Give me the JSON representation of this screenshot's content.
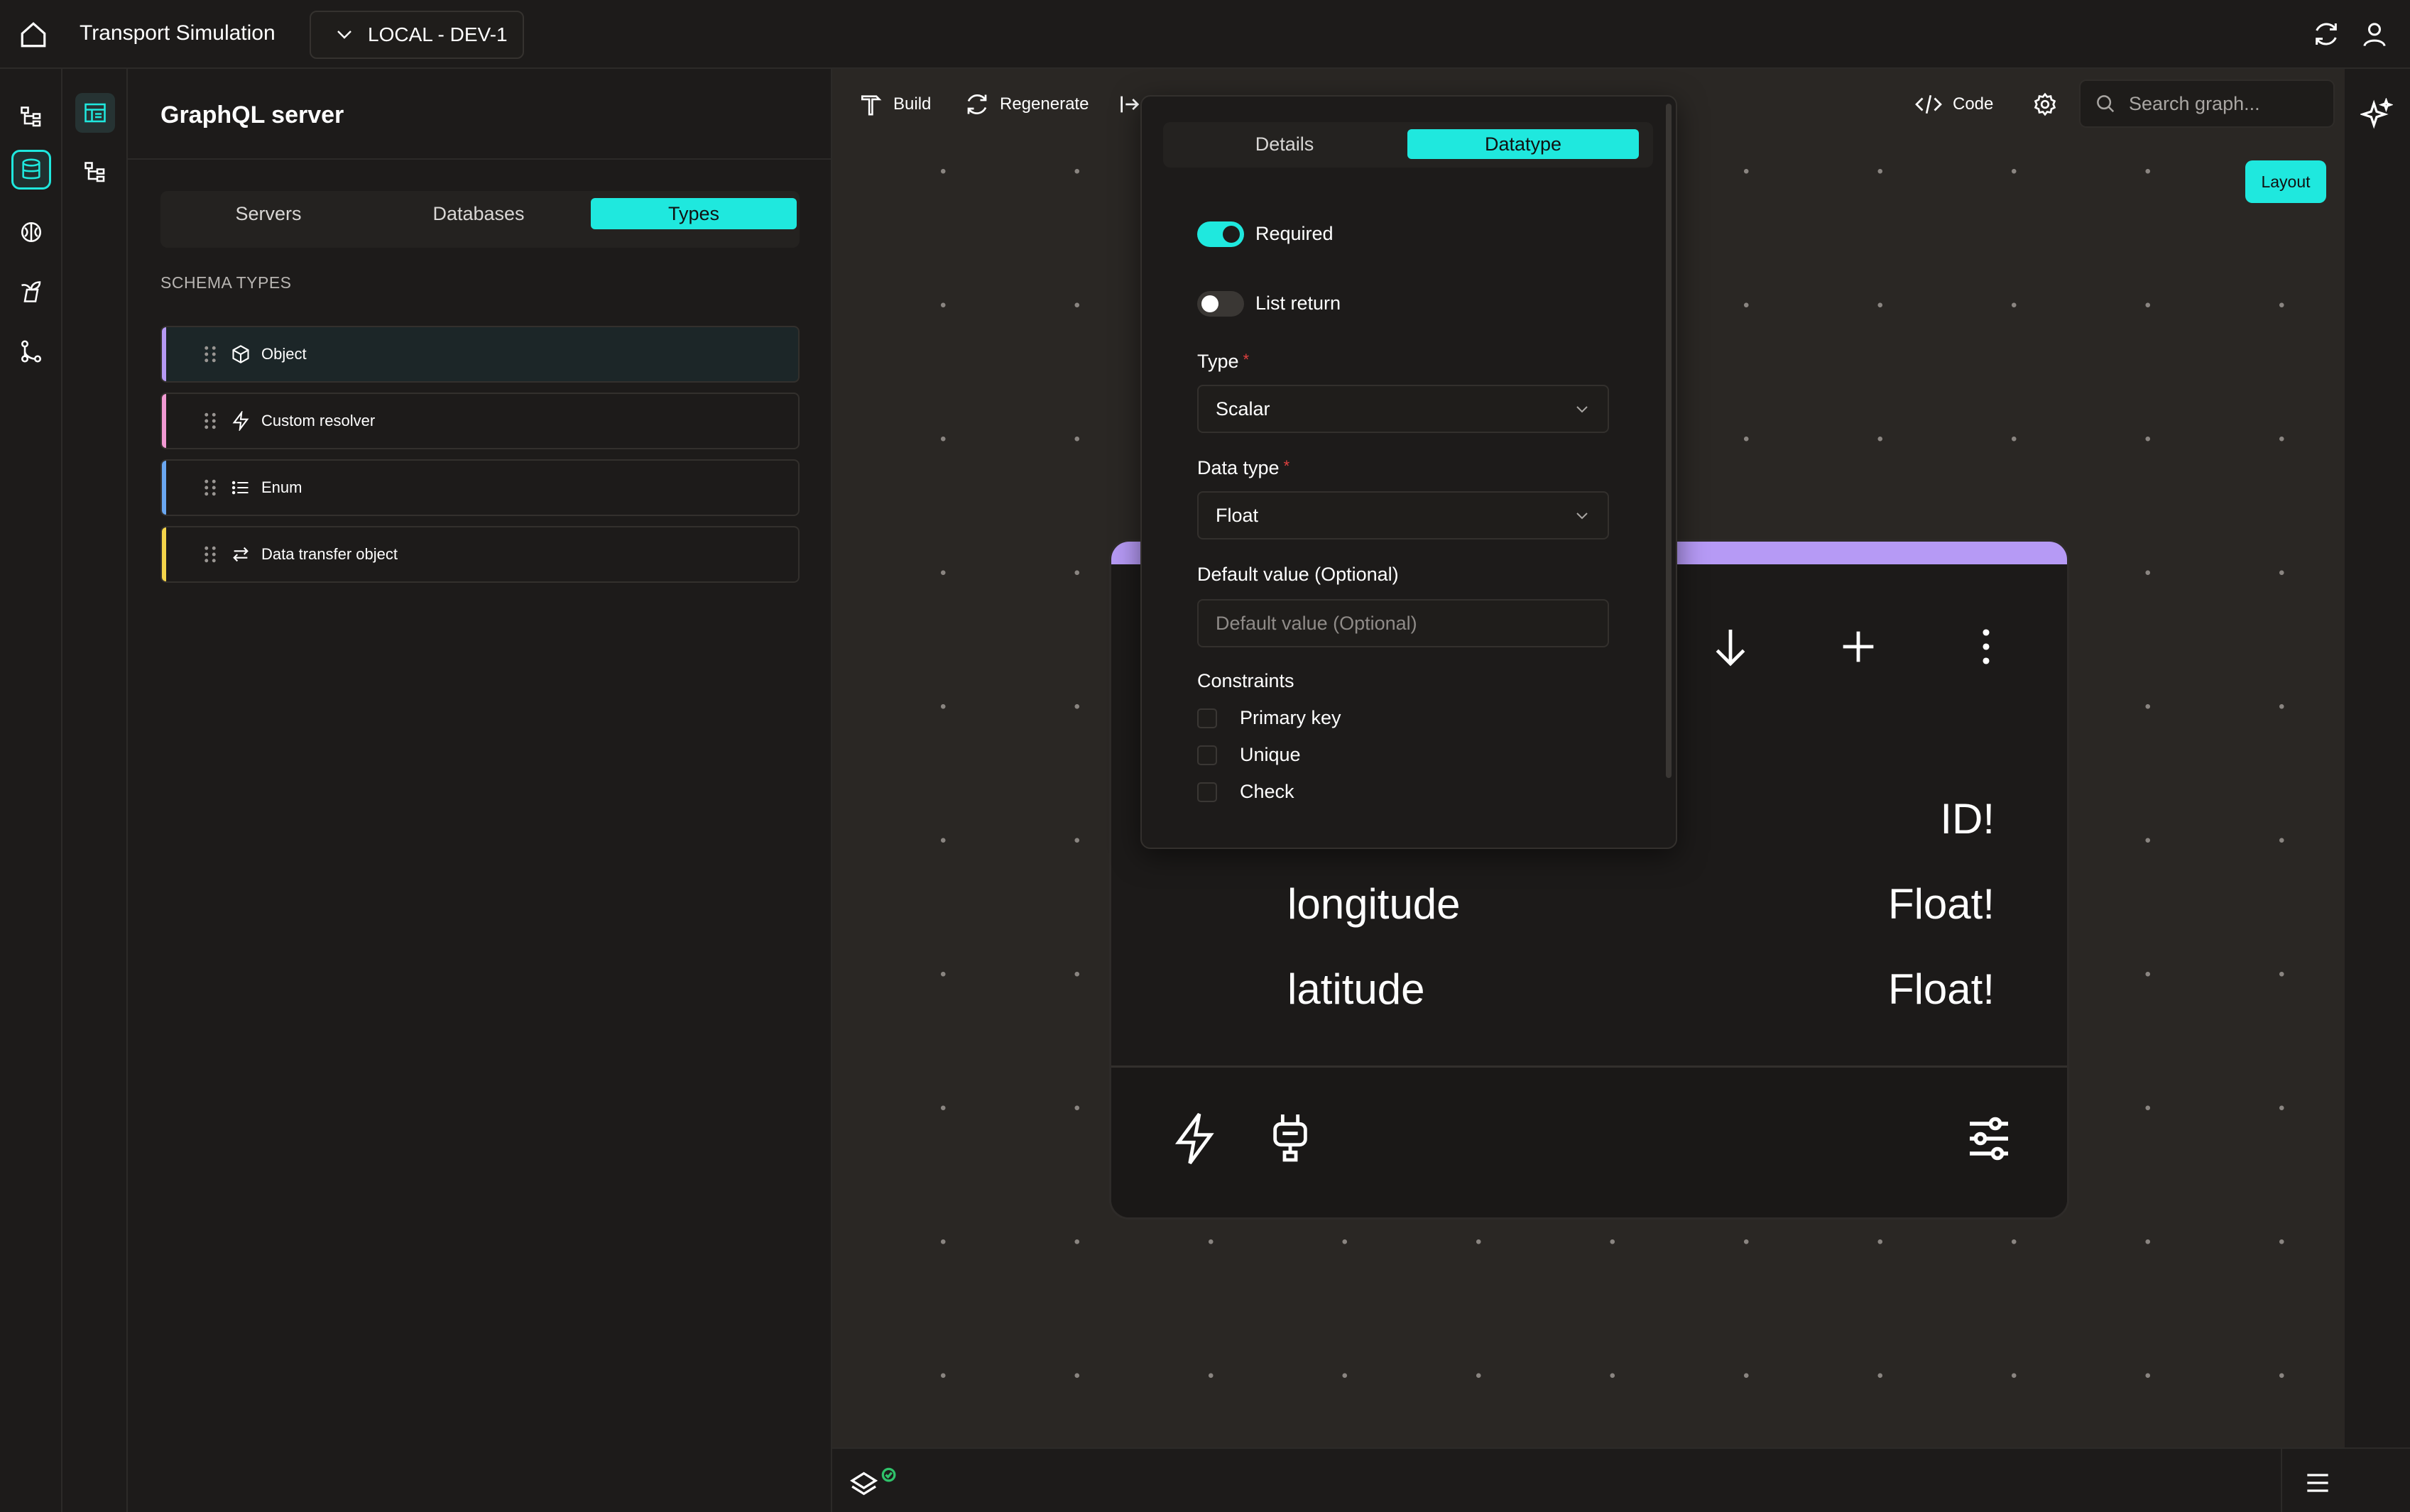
{
  "app": {
    "title": "Transport Simulation",
    "environment": "LOCAL - DEV-1"
  },
  "panel": {
    "title": "GraphQL server",
    "tabs": [
      {
        "label": "Servers"
      },
      {
        "label": "Databases"
      },
      {
        "label": "Types",
        "active": true
      }
    ],
    "section_label": "SCHEMA TYPES",
    "types": [
      {
        "label": "Object",
        "icon": "cube-icon",
        "color": "#b69af5"
      },
      {
        "label": "Custom resolver",
        "icon": "lightning-icon",
        "color": "#f29ad3"
      },
      {
        "label": "Enum",
        "icon": "list-icon",
        "color": "#6aa7f0"
      },
      {
        "label": "Data transfer object",
        "icon": "arrows-swap-icon",
        "color": "#f5d54a"
      }
    ]
  },
  "toolbar": {
    "build": "Build",
    "regenerate": "Regenerate",
    "code": "Code",
    "search_placeholder": "Search graph...",
    "layout": "Layout"
  },
  "popover": {
    "tabs": [
      {
        "label": "Details"
      },
      {
        "label": "Datatype",
        "active": true
      }
    ],
    "required": {
      "label": "Required",
      "on": true
    },
    "list_return": {
      "label": "List return",
      "on": false
    },
    "type": {
      "label": "Type",
      "value": "Scalar"
    },
    "data_type": {
      "label": "Data type",
      "value": "Float"
    },
    "default_value": {
      "label": "Default value (Optional)",
      "placeholder": "Default value (Optional)",
      "value": ""
    },
    "constraints": {
      "label": "Constraints",
      "items": [
        {
          "label": "Primary key",
          "checked": false
        },
        {
          "label": "Unique",
          "checked": false
        },
        {
          "label": "Check",
          "checked": false
        }
      ]
    }
  },
  "node": {
    "header_color": "#b69af5",
    "fields": [
      {
        "name": "",
        "type": "ID!"
      },
      {
        "name": "longitude",
        "type": "Float!"
      },
      {
        "name": "latitude",
        "type": "Float!"
      }
    ]
  },
  "colors": {
    "accent": "#1fe8de",
    "background": "#1d1b1a",
    "canvas": "#2a2724",
    "required_star": "#e0403f"
  }
}
